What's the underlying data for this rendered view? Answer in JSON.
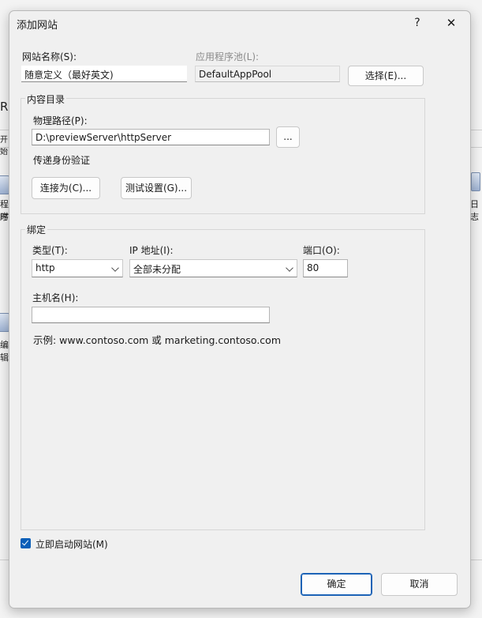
{
  "dialog": {
    "title": "添加网站",
    "help_glyph": "?",
    "close_glyph": "✕"
  },
  "site": {
    "name_label": "网站名称(S):",
    "name_value": "随意定义（最好英文)",
    "pool_label": "应用程序池(L):",
    "pool_value": "DefaultAppPool",
    "select_button": "选择(E)..."
  },
  "content": {
    "group_label": "内容目录",
    "path_label": "物理路径(P):",
    "path_value": "D:\\previewServer\\httpServer",
    "browse_button": "...",
    "auth_label": "传递身份验证",
    "connect_button": "连接为(C)...",
    "test_button": "测试设置(G)..."
  },
  "binding": {
    "group_label": "绑定",
    "type_label": "类型(T):",
    "type_value": "http",
    "ip_label": "IP 地址(I):",
    "ip_value": "全部未分配",
    "port_label": "端口(O):",
    "port_value": "80",
    "host_label": "主机名(H):",
    "host_value": "",
    "example": "示例: www.contoso.com 或 marketing.contoso.com"
  },
  "start_immediately": {
    "checked": true,
    "label": "立即启动网站(M)"
  },
  "footer": {
    "ok_button": "确定",
    "cancel_button": "取消"
  },
  "background_fragments": {
    "left_rf": "RF",
    "left_kai": "开始",
    "left_cheng": "程序",
    "left_shi": "时",
    "left_bian": "编辑",
    "right_rizhi": "日志"
  }
}
